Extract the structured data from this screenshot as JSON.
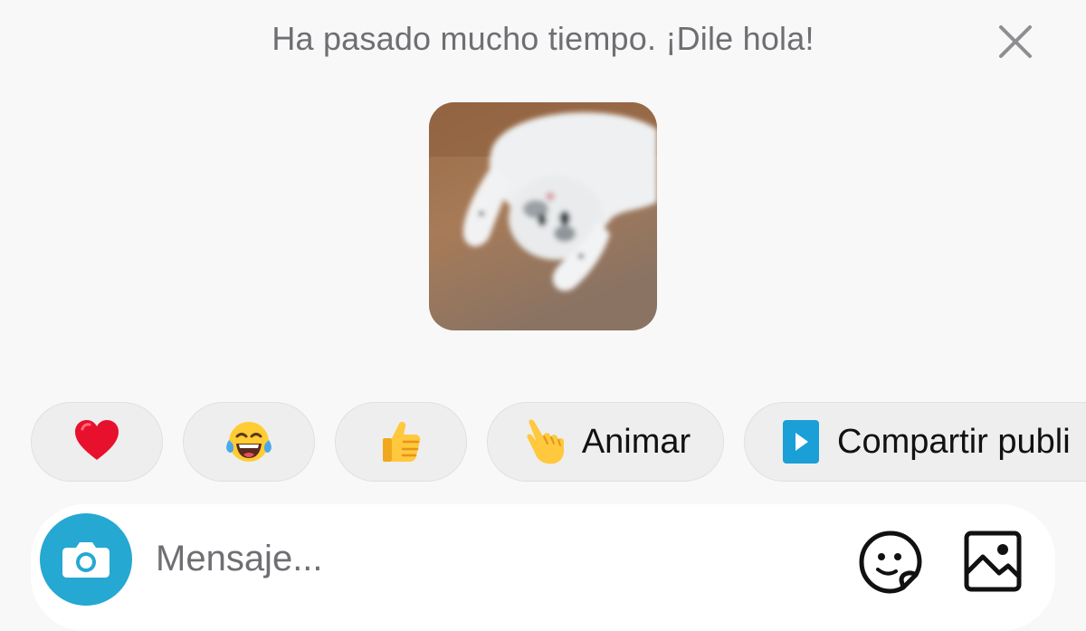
{
  "banner": {
    "text": "Ha pasado mucho tiempo. ¡Dile hola!",
    "close_icon": "close-icon"
  },
  "media": {
    "subject": "white cat lying on its back"
  },
  "quick_replies": [
    {
      "icon": "red-heart-emoji",
      "label": ""
    },
    {
      "icon": "tears-of-joy-emoji",
      "label": ""
    },
    {
      "icon": "thumbs-up-emoji",
      "label": ""
    },
    {
      "icon": "pointing-hand-emoji",
      "label": "Animar"
    },
    {
      "icon": "play-square-icon",
      "label": "Compartir publi"
    }
  ],
  "composer": {
    "placeholder": "Mensaje...",
    "camera_icon": "camera-icon",
    "sticker_icon": "sticker-icon",
    "gallery_icon": "gallery-icon"
  },
  "colors": {
    "background": "#f8f8f8",
    "chip_background": "#eeeeee",
    "accent": "#25a8d2",
    "banner_text": "#6e6e73"
  }
}
